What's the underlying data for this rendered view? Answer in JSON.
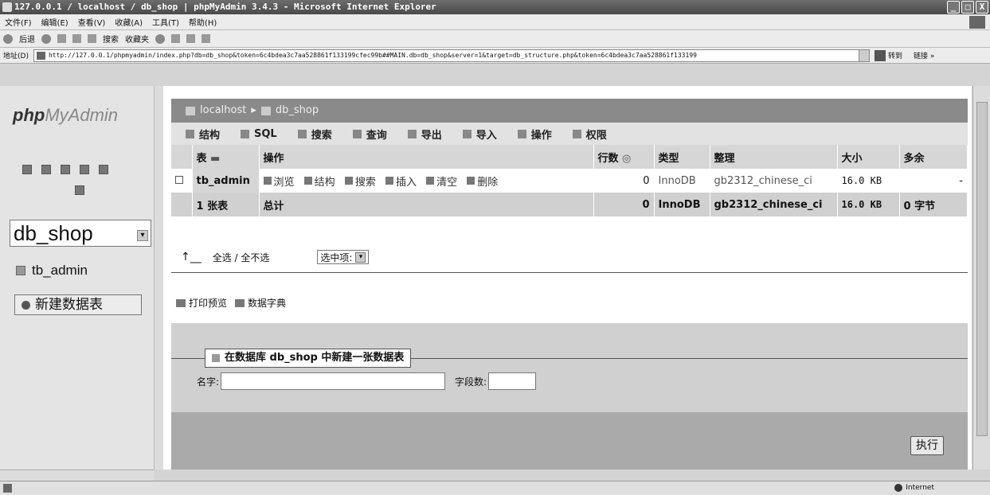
{
  "window": {
    "title": "127.0.0.1 / localhost / db_shop | phpMyAdmin 3.4.3 - Microsoft Internet Explorer",
    "controls": [
      "_",
      "□",
      "X"
    ]
  },
  "menu": [
    "文件(F)",
    "编辑(E)",
    "查看(V)",
    "收藏(A)",
    "工具(T)",
    "帮助(H)"
  ],
  "toolbar": {
    "back": "后退",
    "search": "搜索",
    "favorites": "收藏夹"
  },
  "address": {
    "label": "地址(D)",
    "url": "http://127.0.0.1/phpmyadmin/index.php?db=db_shop&token=6c4bdea3c7aa528861f133199cfec99b##MAIN.db=db_shop&server=1&target=db_structure.php&token=6c4bdea3c7aa528861f133199",
    "go": "转到",
    "links": "链接 »"
  },
  "sidebar": {
    "logo_php": "php",
    "logo_my": "MyAdmin",
    "db_selected": "db_shop",
    "table_link": "tb_admin",
    "new_table": "新建数据表"
  },
  "breadcrumb": {
    "server": "localhost",
    "db": "db_shop"
  },
  "tabs": [
    "结构",
    "SQL",
    "搜索",
    "查询",
    "导出",
    "导入",
    "操作",
    "权限"
  ],
  "table": {
    "headers": {
      "table": "表",
      "actions": "操作",
      "rows": "行数",
      "type": "类型",
      "collation": "整理",
      "size": "大小",
      "overhead": "多余"
    },
    "row": {
      "name": "tb_admin",
      "actions": [
        "浏览",
        "结构",
        "搜索",
        "插入",
        "清空",
        "删除"
      ],
      "rows": "0",
      "type": "InnoDB",
      "collation": "gb2312_chinese_ci",
      "size": "16.0 KB",
      "overhead": "-"
    },
    "summary": {
      "count": "1 张表",
      "label": "总计",
      "rows": "0",
      "type": "InnoDB",
      "collation": "gb2312_chinese_ci",
      "size": "16.0 KB",
      "overhead": "0 字节"
    }
  },
  "selection": {
    "check_all": "全选 / 全不选",
    "with_selected": "选中项:"
  },
  "links": {
    "print": "打印预览",
    "dictionary": "数据字典"
  },
  "create": {
    "legend": "在数据库 db_shop 中新建一张数据表",
    "name_label": "名字:",
    "fields_label": "字段数:",
    "exec": "执行"
  },
  "status": {
    "zone": "Internet"
  }
}
